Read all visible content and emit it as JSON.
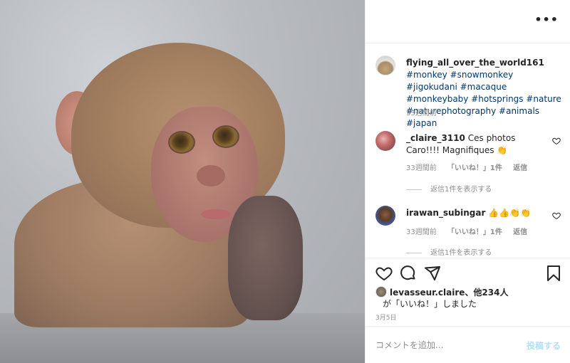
{
  "photo": {
    "alt_subject": "monkey"
  },
  "post": {
    "username": "flying_all_over_the_world161",
    "hashtags": [
      "#monkey",
      "#snowmonkey",
      "#jigokudani",
      "#macaque",
      "#monkeybaby",
      "#hotsprings",
      "#nature",
      "#naturephotography",
      "#animals",
      "#japan"
    ],
    "time_ago": "33週間前",
    "more_icon": "•••"
  },
  "comments": [
    {
      "username": "_claire_3110",
      "text": "Ces photos Caro!!!! Magnifiques 👏",
      "time_ago": "33週間前",
      "likes": "「いいね！」1件",
      "reply": "返信",
      "replies_label": "返信1件を表示する"
    },
    {
      "username": "irawan_subingar",
      "text": "👍👍👏👏",
      "time_ago": "33週間前",
      "likes": "「いいね！」1件",
      "reply": "返信",
      "replies_label": "返信1件を表示する"
    }
  ],
  "likes": {
    "line1_user": "levasseur.claire",
    "line1_rest": "、他234人",
    "line2": "が「いいね！」しました"
  },
  "post_date": "3月5日",
  "comment_box": {
    "placeholder": "コメントを追加...",
    "post_label": "投稿する"
  },
  "colors": {
    "link": "#00376b",
    "muted": "#8e8e8e",
    "post_button": "#b2dffc"
  },
  "icons": {
    "heart": "heart-icon",
    "comment": "comment-icon",
    "share": "share-icon",
    "save": "bookmark-icon",
    "more": "more-icon"
  }
}
